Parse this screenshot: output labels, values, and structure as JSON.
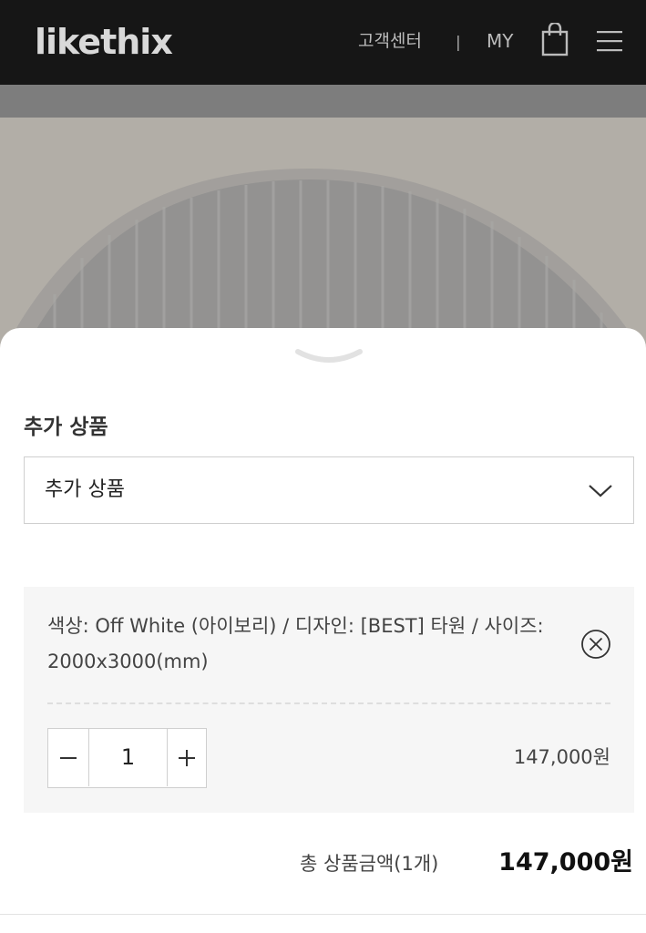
{
  "header": {
    "logo": "likethix",
    "nav_customer_center": "고객센터",
    "nav_separator": "|",
    "nav_my": "MY"
  },
  "icons": {
    "cart": "shopping-bag-icon",
    "menu": "hamburger-menu-icon",
    "sheet_handle": "chevron-down-icon",
    "select_arrow": "chevron-down-icon",
    "remove": "close-circle-icon",
    "minus": "minus-icon",
    "plus": "plus-icon"
  },
  "sheet": {
    "section_label": "추가 상품",
    "addon_select": {
      "value": "추가 상품"
    },
    "option": {
      "description": "색상: Off White (아이보리) / 디자인: [BEST] 타원 / 사이즈: 2000x3000(mm)",
      "quantity": "1",
      "price": "147,000원"
    },
    "total": {
      "label": "총 상품금액(1개)",
      "price": "147,000원"
    }
  },
  "colors": {
    "header_bg": "#161616",
    "option_card_bg": "#f6f6f6",
    "border": "#cfcfcf"
  }
}
